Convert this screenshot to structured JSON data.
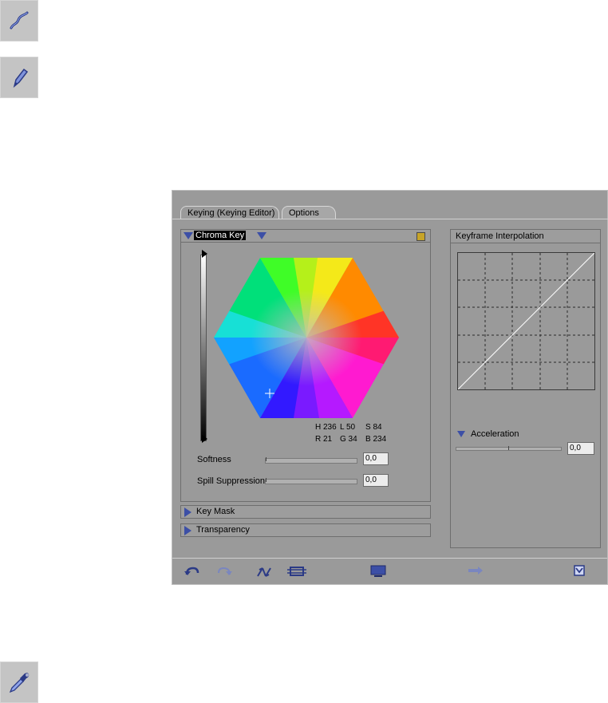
{
  "tools": {
    "curve": "curve-tool",
    "pen": "pen-tool",
    "eyedropper": "eyedropper-tool"
  },
  "tabs": [
    {
      "label": "Keying (Keying Editor)",
      "active": true
    },
    {
      "label": "Options",
      "active": false
    }
  ],
  "chroma": {
    "label": "Chroma Key",
    "swatch_color": "#c7a428",
    "readout": {
      "h": "H 236",
      "l": "L 50",
      "s": "S 84",
      "r": "R 21",
      "g": "G 34",
      "b": "B 234"
    },
    "softness": {
      "label": "Softness",
      "value": "0,0"
    },
    "spill": {
      "label": "Spill Suppression",
      "value": "0,0"
    }
  },
  "sections": {
    "key_mask": "Key Mask",
    "transparency": "Transparency"
  },
  "keyframe": {
    "title": "Keyframe Interpolation",
    "acceleration_label": "Acceleration",
    "acceleration_value": "0,0"
  },
  "colors": {
    "window_bg": "#9a9a9a",
    "accent_blue": "#3c4fa6",
    "swatch": "#c7a428"
  }
}
